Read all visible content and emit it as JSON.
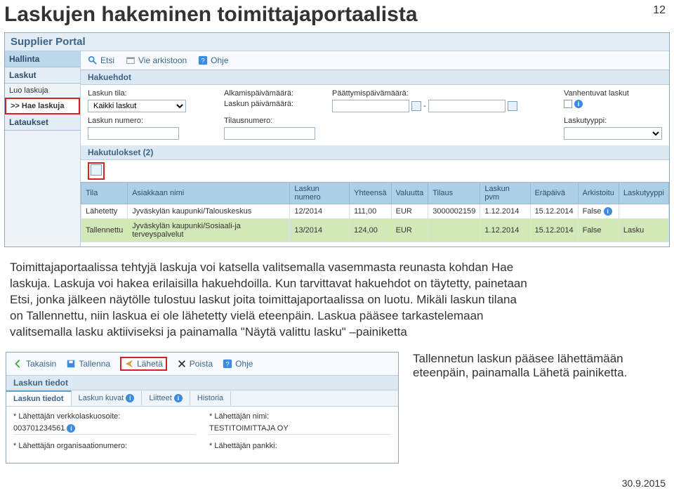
{
  "page": {
    "number": "12",
    "title": "Laskujen hakeminen toimittajaportaalista",
    "footer_date": "30.9.2015"
  },
  "portal": {
    "header": "Supplier Portal",
    "sidebar": {
      "hallinta": "Hallinta",
      "laskut": "Laskut",
      "luo": "Luo laskuja",
      "hae": ">> Hae laskuja",
      "lataukset": "Lataukset"
    },
    "toolbar": {
      "etsi": "Etsi",
      "vie": "Vie arkistoon",
      "ohje": "Ohje"
    },
    "criteria": {
      "hdr": "Hakuehdot",
      "tila_lbl": "Laskun tila:",
      "tila_val": "Kaikki laskut",
      "lnum_lbl": "Laskun numero:",
      "alk_lbl": "Alkamispäivämäärä:",
      "paat_lbl": "Päättymispäivämäärä:",
      "pvm_lbl": "Laskun päivämäärä:",
      "sep": "-",
      "tilaus_lbl": "Tilausnumero:",
      "vanh_lbl": "Vanhentuvat laskut",
      "tyyppi_lbl": "Laskutyyppi:"
    },
    "results": {
      "hdr": "Hakutulokset (2)",
      "cols": {
        "tila": "Tila",
        "asiakas": "Asiakkaan nimi",
        "lnum": "Laskun numero",
        "yht": "Yhteensä",
        "val": "Valuutta",
        "tilaus": "Tilaus",
        "lpvm": "Laskun pvm",
        "erapvm": "Eräpäivä",
        "ark": "Arkistoitu",
        "tyyp": "Laskutyyppi"
      },
      "rows": [
        {
          "tila": "Lähetetty",
          "asiakas": "Jyväskylän kaupunki/Talouskeskus",
          "lnum": "12/2014",
          "yht": "111,00",
          "val": "EUR",
          "tilaus": "3000002159",
          "lpvm": "1.12.2014",
          "erapvm": "15.12.2014",
          "ark": "False",
          "ark_i": "i",
          "tyyp": ""
        },
        {
          "tila": "Tallennettu",
          "asiakas": "Jyväskylän kaupunki/Sosiaali-ja terveyspalvelut",
          "lnum": "13/2014",
          "yht": "124,00",
          "val": "EUR",
          "tilaus": "",
          "lpvm": "1.12.2014",
          "erapvm": "15.12.2014",
          "ark": "False",
          "tyyp": "Lasku"
        }
      ]
    }
  },
  "para": "Toimittajaportaalissa tehtyjä laskuja voi katsella valitsemalla vasemmasta reunasta kohdan Hae laskuja. Laskuja voi hakea erilaisilla hakuehdoilla. Kun tarvittavat hakuehdot on täytetty, painetaan Etsi, jonka jälkeen näytölle tulostuu laskut joita toimittajaportaalissa on luotu. Mikäli laskun tilana on Tallennettu, niin laskua ei ole lähetetty vielä eteenpäin. Laskua pääsee tarkastelemaan valitsemalla lasku aktiiviseksi ja painamalla \"Näytä valittu lasku\" –painiketta",
  "detail": {
    "toolbar": {
      "takaisin": "Takaisin",
      "tallenna": "Tallenna",
      "laheta": "Lähetä",
      "poista": "Poista",
      "ohje": "Ohje"
    },
    "hdr": "Laskun tiedot",
    "tabs": {
      "t1": "Laskun tiedot",
      "t2": "Laskun kuvat",
      "t3": "Liitteet",
      "t4": "Historia",
      "i": "i"
    },
    "fields": {
      "osoite_lbl": "* Lähettäjän verkkolaskuosoite:",
      "osoite_val": "003701234561",
      "nimi_lbl": "* Lähettäjän nimi:",
      "nimi_val": "TESTITOIMITTAJA OY",
      "org_lbl": "* Lähettäjän organisaationumero:",
      "pankki_lbl": "* Lähettäjän pankki:"
    }
  },
  "caption": "Tallennetun laskun pääsee lähettämään eteenpäin, painamalla Lähetä painiketta."
}
